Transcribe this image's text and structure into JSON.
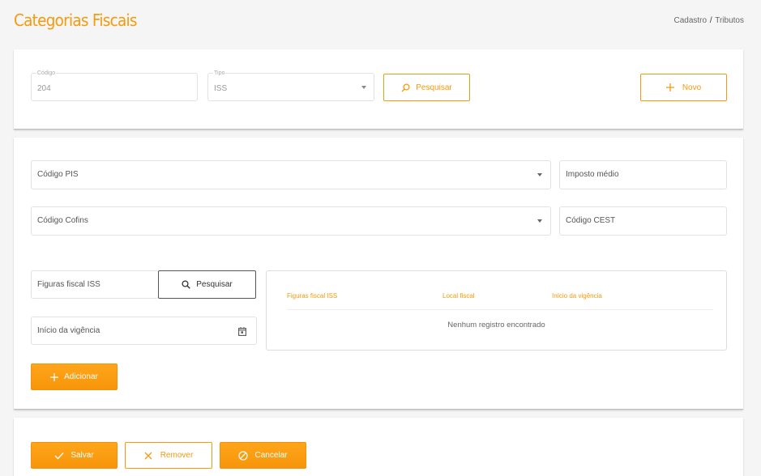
{
  "header": {
    "title": "Categorias Fiscais",
    "breadcrumb": {
      "parent": "Cadastro",
      "separator": "/",
      "current": "Tributos"
    }
  },
  "search": {
    "codigo": {
      "label": "Código",
      "value": "204"
    },
    "tipo": {
      "label": "Tipo",
      "value": "ISS"
    },
    "pesquisar_label": "Pesquisar",
    "novo_label": "Novo"
  },
  "form": {
    "codigo_pis": "Código PIS",
    "imposto_medio": "Imposto médio",
    "codigo_cofins": "Código Cofins",
    "codigo_cest": "Código CEST",
    "figuras_fiscal_iss": "Figuras fiscal ISS",
    "pesquisar_label": "Pesquisar",
    "inicio_vigencia": "Início da vigência",
    "adicionar_label": "Adicionar"
  },
  "table": {
    "columns": [
      "Figuras fiscal ISS",
      "Local fiscal",
      "Início da vigência"
    ],
    "empty_message": "Nenhum registro encontrado"
  },
  "actions": {
    "salvar_label": "Salvar",
    "remover_label": "Remover",
    "cancelar_label": "Cancelar"
  },
  "colors": {
    "accent": "#f59a0c",
    "button_fill": "#ff9d0a"
  },
  "icons": [
    "search-icon",
    "plus-icon",
    "caret-down-icon",
    "calendar-icon",
    "check-icon",
    "close-icon",
    "cancel-icon"
  ]
}
